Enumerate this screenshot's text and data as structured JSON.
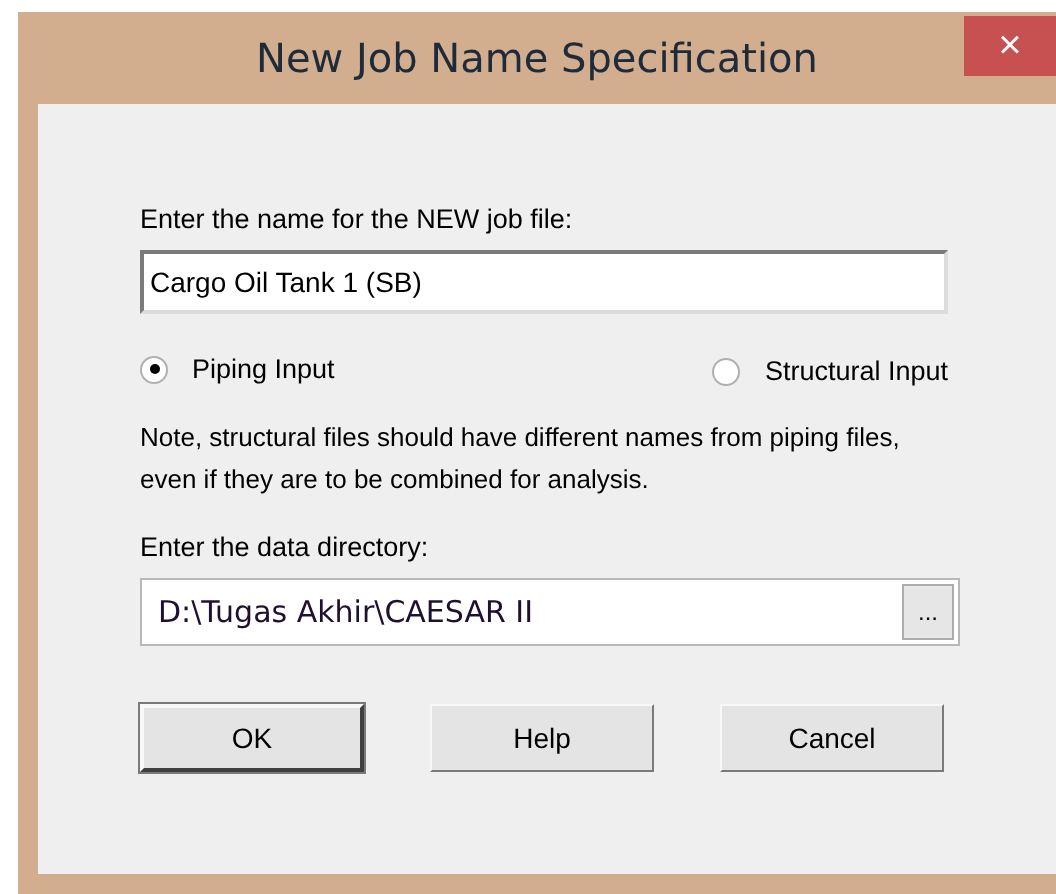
{
  "window": {
    "title": "New Job Name Specification",
    "close": "×"
  },
  "name_field": {
    "label": "Enter the name for the NEW job file:",
    "value": "Cargo Oil Tank 1 (SB)"
  },
  "input_type": [
    {
      "label": "Piping Input",
      "selected": true
    },
    {
      "label": "Structural Input",
      "selected": false
    }
  ],
  "note": "Note, structural files should have different names from piping files, even if they are to be combined for analysis.",
  "directory": {
    "label": "Enter the data directory:",
    "value": "D:\\Tugas Akhir\\CAESAR II",
    "browse": "..."
  },
  "buttons": [
    {
      "label": "OK",
      "default": true
    },
    {
      "label": "Help",
      "default": false
    },
    {
      "label": "Cancel",
      "default": false
    }
  ]
}
